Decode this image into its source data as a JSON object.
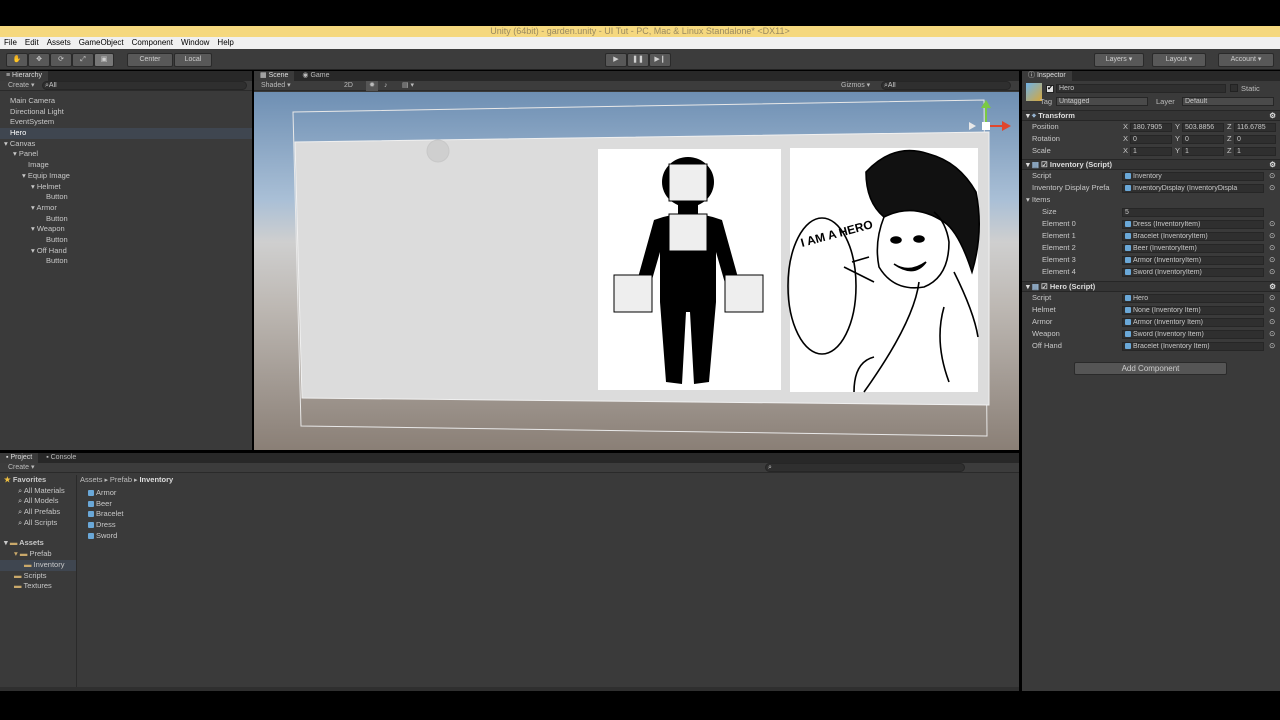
{
  "window": {
    "title": "Unity (64bit) - garden.unity - UI Tut - PC, Mac & Linux Standalone* <DX11>"
  },
  "menu": [
    "File",
    "Edit",
    "Assets",
    "GameObject",
    "Component",
    "Window",
    "Help"
  ],
  "toolbar": {
    "center": "Center",
    "local": "Local",
    "layers": "Layers",
    "layout": "Layout",
    "account": "Account"
  },
  "hierarchy": {
    "tab": "Hierarchy",
    "create": "Create",
    "search": "All",
    "items": [
      {
        "label": "Main Camera",
        "depth": 0
      },
      {
        "label": "Directional Light",
        "depth": 0
      },
      {
        "label": "EventSystem",
        "depth": 0
      },
      {
        "label": "Hero",
        "depth": 0,
        "selected": true
      },
      {
        "label": "Canvas",
        "depth": 0,
        "fold": true
      },
      {
        "label": "Panel",
        "depth": 1,
        "fold": true
      },
      {
        "label": "Image",
        "depth": 2
      },
      {
        "label": "Equip Image",
        "depth": 2,
        "fold": true
      },
      {
        "label": "Helmet",
        "depth": 3,
        "fold": true
      },
      {
        "label": "Button",
        "depth": 4
      },
      {
        "label": "Armor",
        "depth": 3,
        "fold": true
      },
      {
        "label": "Button",
        "depth": 4
      },
      {
        "label": "Weapon",
        "depth": 3,
        "fold": true
      },
      {
        "label": "Button",
        "depth": 4
      },
      {
        "label": "Off Hand",
        "depth": 3,
        "fold": true
      },
      {
        "label": "Button",
        "depth": 4
      }
    ]
  },
  "scene": {
    "tab_scene": "Scene",
    "tab_game": "Game",
    "shaded": "Shaded",
    "mode2d": "2D",
    "gizmos": "Gizmos",
    "search": "All",
    "bubble": "I AM A HERO"
  },
  "project": {
    "tab_project": "Project",
    "tab_console": "Console",
    "create": "Create",
    "favorites_title": "Favorites",
    "favorites": [
      "All Materials",
      "All Models",
      "All Prefabs",
      "All Scripts"
    ],
    "assets_title": "Assets",
    "tree": [
      {
        "label": "Prefab",
        "depth": 1
      },
      {
        "label": "Inventory",
        "depth": 2,
        "selected": true
      },
      {
        "label": "Scripts",
        "depth": 1
      },
      {
        "label": "Textures",
        "depth": 1
      }
    ],
    "breadcrumb": [
      "Assets",
      "Prefab",
      "Inventory"
    ],
    "files": [
      "Armor",
      "Beer",
      "Bracelet",
      "Dress",
      "Sword"
    ]
  },
  "inspector": {
    "tab": "Inspector",
    "name": "Hero",
    "static": "Static",
    "tag_label": "Tag",
    "tag_value": "Untagged",
    "layer_label": "Layer",
    "layer_value": "Default",
    "transform": {
      "title": "Transform",
      "rows": [
        {
          "label": "Position",
          "x": "180.7905",
          "y": "503.8856",
          "z": "116.6785"
        },
        {
          "label": "Rotation",
          "x": "0",
          "y": "0",
          "z": "0"
        },
        {
          "label": "Scale",
          "x": "1",
          "y": "1",
          "z": "1"
        }
      ]
    },
    "inventory": {
      "title": "Inventory (Script)",
      "script_label": "Script",
      "script_value": "Inventory",
      "display_label": "Inventory Display Prefa",
      "display_value": "InventoryDisplay (InventoryDispla",
      "items_label": "Items",
      "size_label": "Size",
      "size_value": "5",
      "elements": [
        {
          "label": "Element 0",
          "value": "Dress (InventoryItem)"
        },
        {
          "label": "Element 1",
          "value": "Bracelet (InventoryItem)"
        },
        {
          "label": "Element 2",
          "value": "Beer (InventoryItem)"
        },
        {
          "label": "Element 3",
          "value": "Armor (InventoryItem)"
        },
        {
          "label": "Element 4",
          "value": "Sword (InventoryItem)"
        }
      ]
    },
    "hero": {
      "title": "Hero (Script)",
      "rows": [
        {
          "label": "Script",
          "value": "Hero"
        },
        {
          "label": "Helmet",
          "value": "None (Inventory Item)"
        },
        {
          "label": "Armor",
          "value": "Armor (Inventory Item)"
        },
        {
          "label": "Weapon",
          "value": "Sword (Inventory Item)"
        },
        {
          "label": "Off Hand",
          "value": "Bracelet (Inventory Item)"
        }
      ]
    },
    "add_component": "Add Component"
  }
}
